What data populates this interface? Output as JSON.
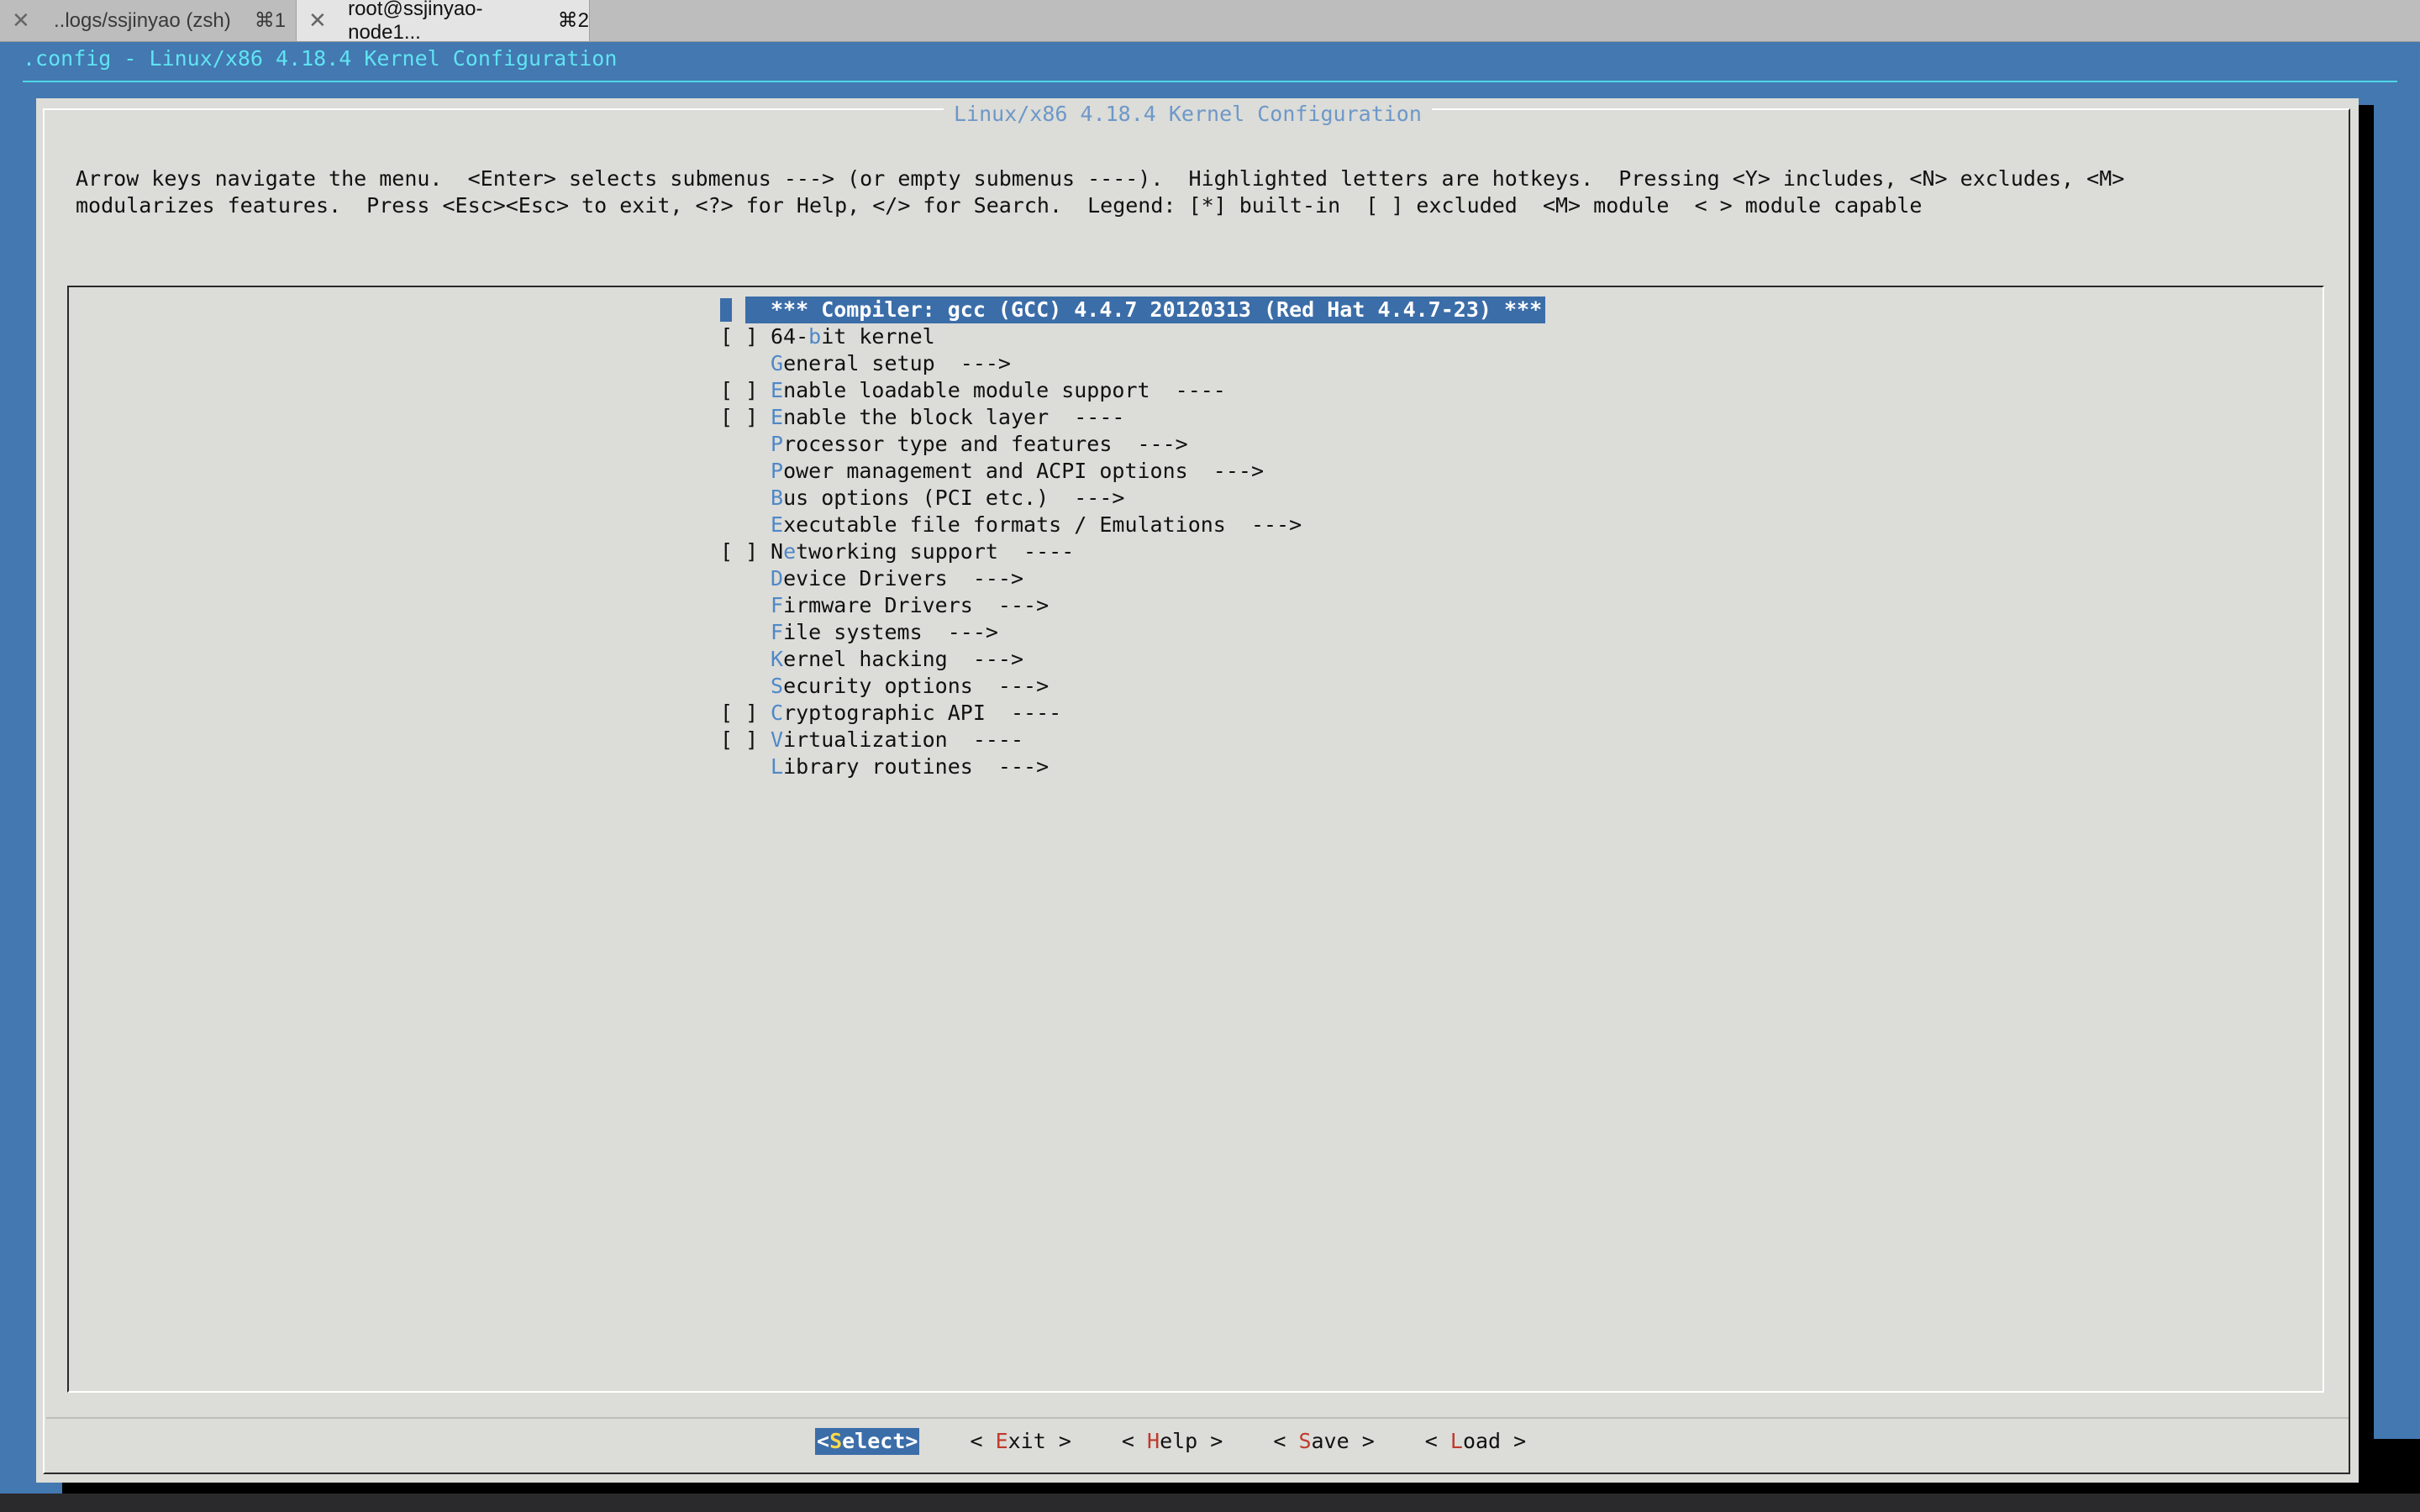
{
  "tabs": [
    {
      "label": "..logs/ssjinyao (zsh)",
      "shortcut": "⌘1",
      "active": false
    },
    {
      "label": "root@ssjinyao-node1...",
      "shortcut": "⌘2",
      "active": true
    }
  ],
  "terminal": {
    "title": ".config - Linux/x86 4.18.4 Kernel Configuration"
  },
  "dialog": {
    "title": "Linux/x86 4.18.4 Kernel Configuration",
    "help_line1": "Arrow keys navigate the menu.  <Enter> selects submenus ---> (or empty submenus ----).  Highlighted letters are hotkeys.  Pressing <Y> includes, <N> excludes, <M>",
    "help_line2": "modularizes features.  Press <Esc><Esc> to exit, <?> for Help, </> for Search.  Legend: [*] built-in  [ ] excluded  <M> module  < > module capable"
  },
  "menu": {
    "selected_item": "*** Compiler: gcc (GCC) 4.4.7 20120313 (Red Hat 4.4.7-23) ***",
    "items": [
      {
        "box": "[ ]",
        "pre": "64-",
        "hk": "b",
        "post": "it kernel"
      },
      {
        "box": "",
        "pre": "",
        "hk": "G",
        "post": "eneral setup  --->"
      },
      {
        "box": "[ ]",
        "pre": "",
        "hk": "E",
        "post": "nable loadable module support  ----"
      },
      {
        "box": "[ ]",
        "pre": "",
        "hk": "E",
        "post": "nable the block layer  ----"
      },
      {
        "box": "",
        "pre": "",
        "hk": "P",
        "post": "rocessor type and features  --->"
      },
      {
        "box": "",
        "pre": "",
        "hk": "P",
        "post": "ower management and ACPI options  --->"
      },
      {
        "box": "",
        "pre": "",
        "hk": "B",
        "post": "us options (PCI etc.)  --->"
      },
      {
        "box": "",
        "pre": "",
        "hk": "E",
        "post": "xecutable file formats / Emulations  --->"
      },
      {
        "box": "[ ]",
        "pre": "N",
        "hk": "e",
        "post": "tworking support  ----"
      },
      {
        "box": "",
        "pre": "",
        "hk": "D",
        "post": "evice Drivers  --->"
      },
      {
        "box": "",
        "pre": "",
        "hk": "F",
        "post": "irmware Drivers  --->"
      },
      {
        "box": "",
        "pre": "",
        "hk": "F",
        "post": "ile systems  --->"
      },
      {
        "box": "",
        "pre": "",
        "hk": "K",
        "post": "ernel hacking  --->"
      },
      {
        "box": "",
        "pre": "",
        "hk": "S",
        "post": "ecurity options  --->"
      },
      {
        "box": "[ ]",
        "pre": "",
        "hk": "C",
        "post": "ryptographic API  ----"
      },
      {
        "box": "[ ]",
        "pre": "",
        "hk": "V",
        "post": "irtualization  ----"
      },
      {
        "box": "",
        "pre": "",
        "hk": "L",
        "post": "ibrary routines  --->"
      }
    ]
  },
  "buttons": {
    "select": {
      "open": "<",
      "hk": "S",
      "rest": "elect",
      "close": ">"
    },
    "exit": {
      "open": "< ",
      "hk": "E",
      "rest": "xit",
      "close": " >"
    },
    "help": {
      "open": "< ",
      "hk": "H",
      "rest": "elp",
      "close": " >"
    },
    "save": {
      "open": "< ",
      "hk": "S",
      "rest": "ave",
      "close": " >"
    },
    "load": {
      "open": "< ",
      "hk": "L",
      "rest": "oad",
      "close": " >"
    }
  }
}
